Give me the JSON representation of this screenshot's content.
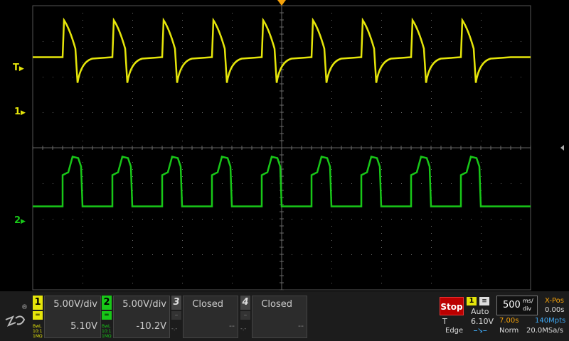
{
  "colors": {
    "ch1": "#e5e50a",
    "ch2": "#18c718",
    "grid": "#6a6a6a",
    "panel": "#2c2c2c",
    "stop": "#bb0000",
    "blue_text": "#3fa9f5",
    "orange_text": "#f5a20a"
  },
  "markers": {
    "trigger_label": "T",
    "ch1_label": "1",
    "ch2_label": "2"
  },
  "waveforms": {
    "period_div": 1.0,
    "ch1_baseline_div": 1.45,
    "ch2_baseline_div": 5.65
  },
  "channels": [
    {
      "number": "1",
      "coupling": "",
      "volts_per_div": "5.00V/div",
      "offset": "5.10V",
      "small_lines": [
        "BwL",
        "10:1",
        "1MΩ"
      ]
    },
    {
      "number": "2",
      "coupling": "",
      "volts_per_div": "5.00V/div",
      "offset": "-10.2V",
      "small_lines": [
        "BwL",
        "10:1",
        "1MΩ"
      ]
    },
    {
      "number": "3",
      "status": "Closed",
      "offset": "--",
      "small": "-.-"
    },
    {
      "number": "4",
      "status": "Closed",
      "offset": "--",
      "small": "-.-"
    }
  ],
  "trigger": {
    "stop_label": "Stop",
    "source": "1",
    "mode": "Auto",
    "letter": "T",
    "level": "6.10V",
    "type": "Edge"
  },
  "timebase": {
    "value": "500",
    "unit_top": "ms/",
    "unit_bottom": "div",
    "xpos_label": "X-Pos",
    "xpos_value": "0.00s",
    "span": "7.00s",
    "mpts": "140Mpts",
    "mode": "Norm",
    "rate": "20.0MSa/s"
  },
  "logo": {
    "registered": "®"
  }
}
